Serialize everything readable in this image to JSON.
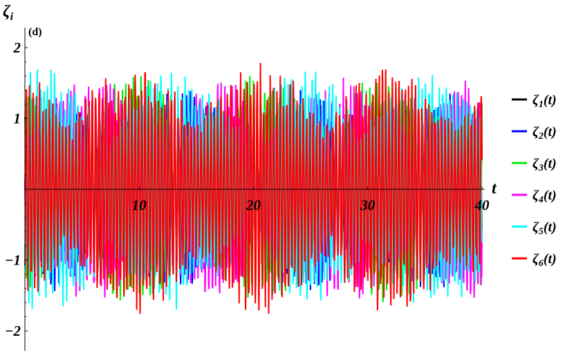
{
  "chart_data": {
    "type": "line",
    "panel_label": "(d)",
    "xlabel": "t",
    "ylabel": "ζ",
    "ylabel_sub": "i",
    "xlim": [
      0,
      40
    ],
    "ylim": [
      -2.1,
      2.1
    ],
    "x_ticks": [
      10,
      20,
      30,
      40
    ],
    "y_ticks": [
      2,
      1,
      -1,
      -2
    ],
    "y_tick_labels": [
      "2",
      "1",
      "−1",
      "−2"
    ],
    "legend_position": "right",
    "series": [
      {
        "name": "ζ1(t)",
        "base": "ζ",
        "sub": "1",
        "suffix": "(t)",
        "color": "#000000",
        "amplitude": 1.1,
        "envelope_phase": 0.0,
        "freq": 7.9
      },
      {
        "name": "ζ2(t)",
        "base": "ζ",
        "sub": "2",
        "suffix": "(t)",
        "color": "#0000ff",
        "amplitude": 1.45,
        "envelope_phase": 1.0,
        "freq": 8.3
      },
      {
        "name": "ζ3(t)",
        "base": "ζ",
        "sub": "3",
        "suffix": "(t)",
        "color": "#00ee00",
        "amplitude": 1.65,
        "envelope_phase": 2.1,
        "freq": 8.7
      },
      {
        "name": "ζ4(t)",
        "base": "ζ",
        "sub": "4",
        "suffix": "(t)",
        "color": "#ff00ff",
        "amplitude": 1.6,
        "envelope_phase": 3.1,
        "freq": 9.1
      },
      {
        "name": "ζ5(t)",
        "base": "ζ",
        "sub": "5",
        "suffix": "(t)",
        "color": "#00ffff",
        "amplitude": 1.75,
        "envelope_phase": 4.2,
        "freq": 9.5
      },
      {
        "name": "ζ6(t)",
        "base": "ζ",
        "sub": "6",
        "suffix": "(t)",
        "color": "#ff0000",
        "amplitude": 1.8,
        "envelope_phase": 5.2,
        "freq": 9.9
      }
    ]
  }
}
